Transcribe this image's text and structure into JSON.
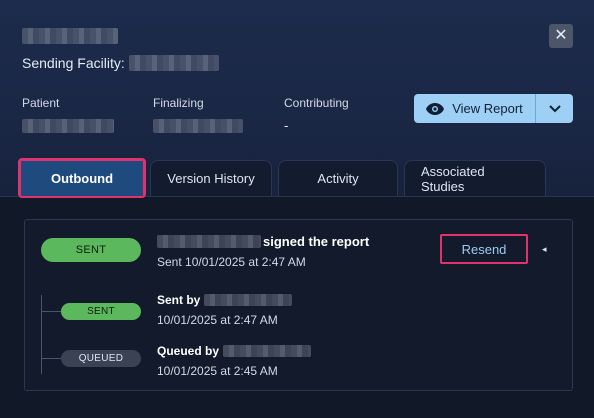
{
  "header": {
    "sending_facility_label": "Sending Facility:",
    "close_glyph": "✕"
  },
  "meta": {
    "patient_label": "Patient",
    "finalizing_label": "Finalizing",
    "contributing_label": "Contributing",
    "contributing_value": "-"
  },
  "view_report": {
    "label": "View Report",
    "icon": "eye-icon",
    "dropdown_icon": "chevron-down-icon",
    "color": "#9ed0f5"
  },
  "tabs": [
    {
      "label": "Outbound",
      "active": true
    },
    {
      "label": "Version History",
      "active": false
    },
    {
      "label": "Activity",
      "active": false
    },
    {
      "label": "Associated Studies",
      "active": false
    }
  ],
  "outbound": {
    "main_event": {
      "status": "SENT",
      "action": "signed the report",
      "timestamp": "Sent 10/01/2025 at 2:47 AM"
    },
    "resend_label": "Resend",
    "caret_glyph": "◂",
    "history": [
      {
        "status": "SENT",
        "who_label": "Sent by",
        "timestamp": "10/01/2025 at 2:47 AM"
      },
      {
        "status": "QUEUED",
        "who_label": "Queued by",
        "timestamp": "10/01/2025 at 2:45 AM"
      }
    ]
  },
  "colors": {
    "sent": "#5cb85c",
    "queued": "#3a4254",
    "highlight": "#e0336e",
    "active_tab": "#1f4a7d"
  }
}
